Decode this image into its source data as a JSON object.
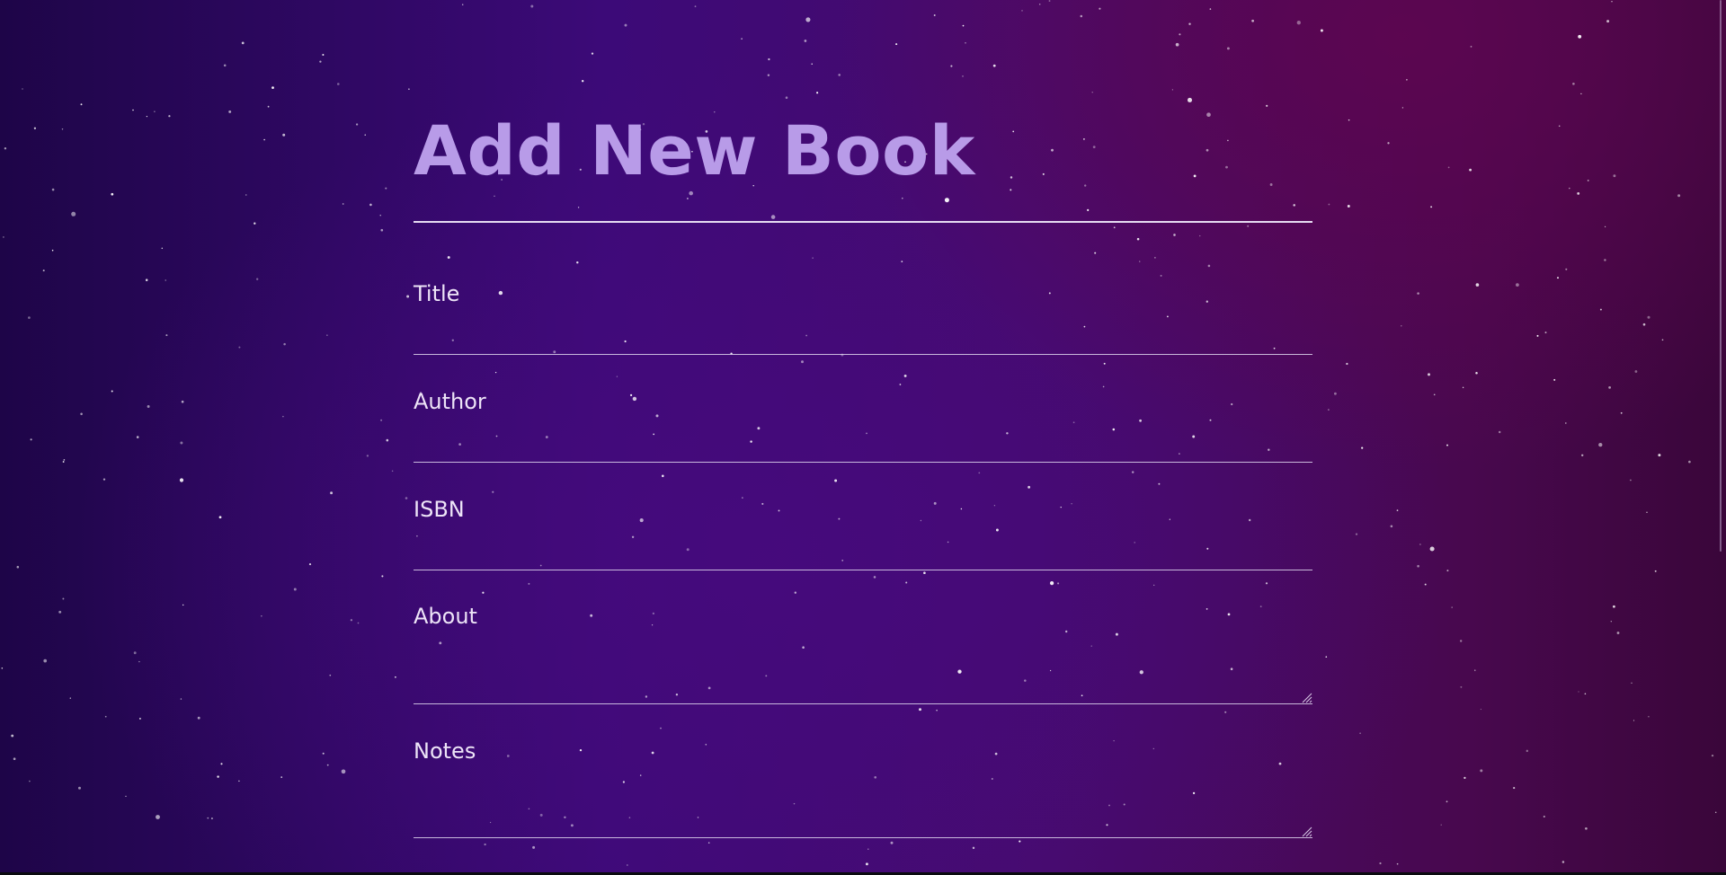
{
  "page": {
    "title": "Add New Book"
  },
  "form": {
    "fields": [
      {
        "label": "Title",
        "value": "",
        "type": "text"
      },
      {
        "label": "Author",
        "value": "",
        "type": "text"
      },
      {
        "label": "ISBN",
        "value": "",
        "type": "text"
      },
      {
        "label": "About",
        "value": "",
        "type": "textarea"
      },
      {
        "label": "Notes",
        "value": "",
        "type": "textarea"
      }
    ]
  },
  "colors": {
    "title": "#b89be8",
    "label": "#ede4f7",
    "rule": "#e6dcf2",
    "background_left": "#1e0548",
    "background_center": "#3c0a78",
    "background_right": "#48084e"
  },
  "icons": {
    "textarea_resize": "resize-grip-icon"
  }
}
